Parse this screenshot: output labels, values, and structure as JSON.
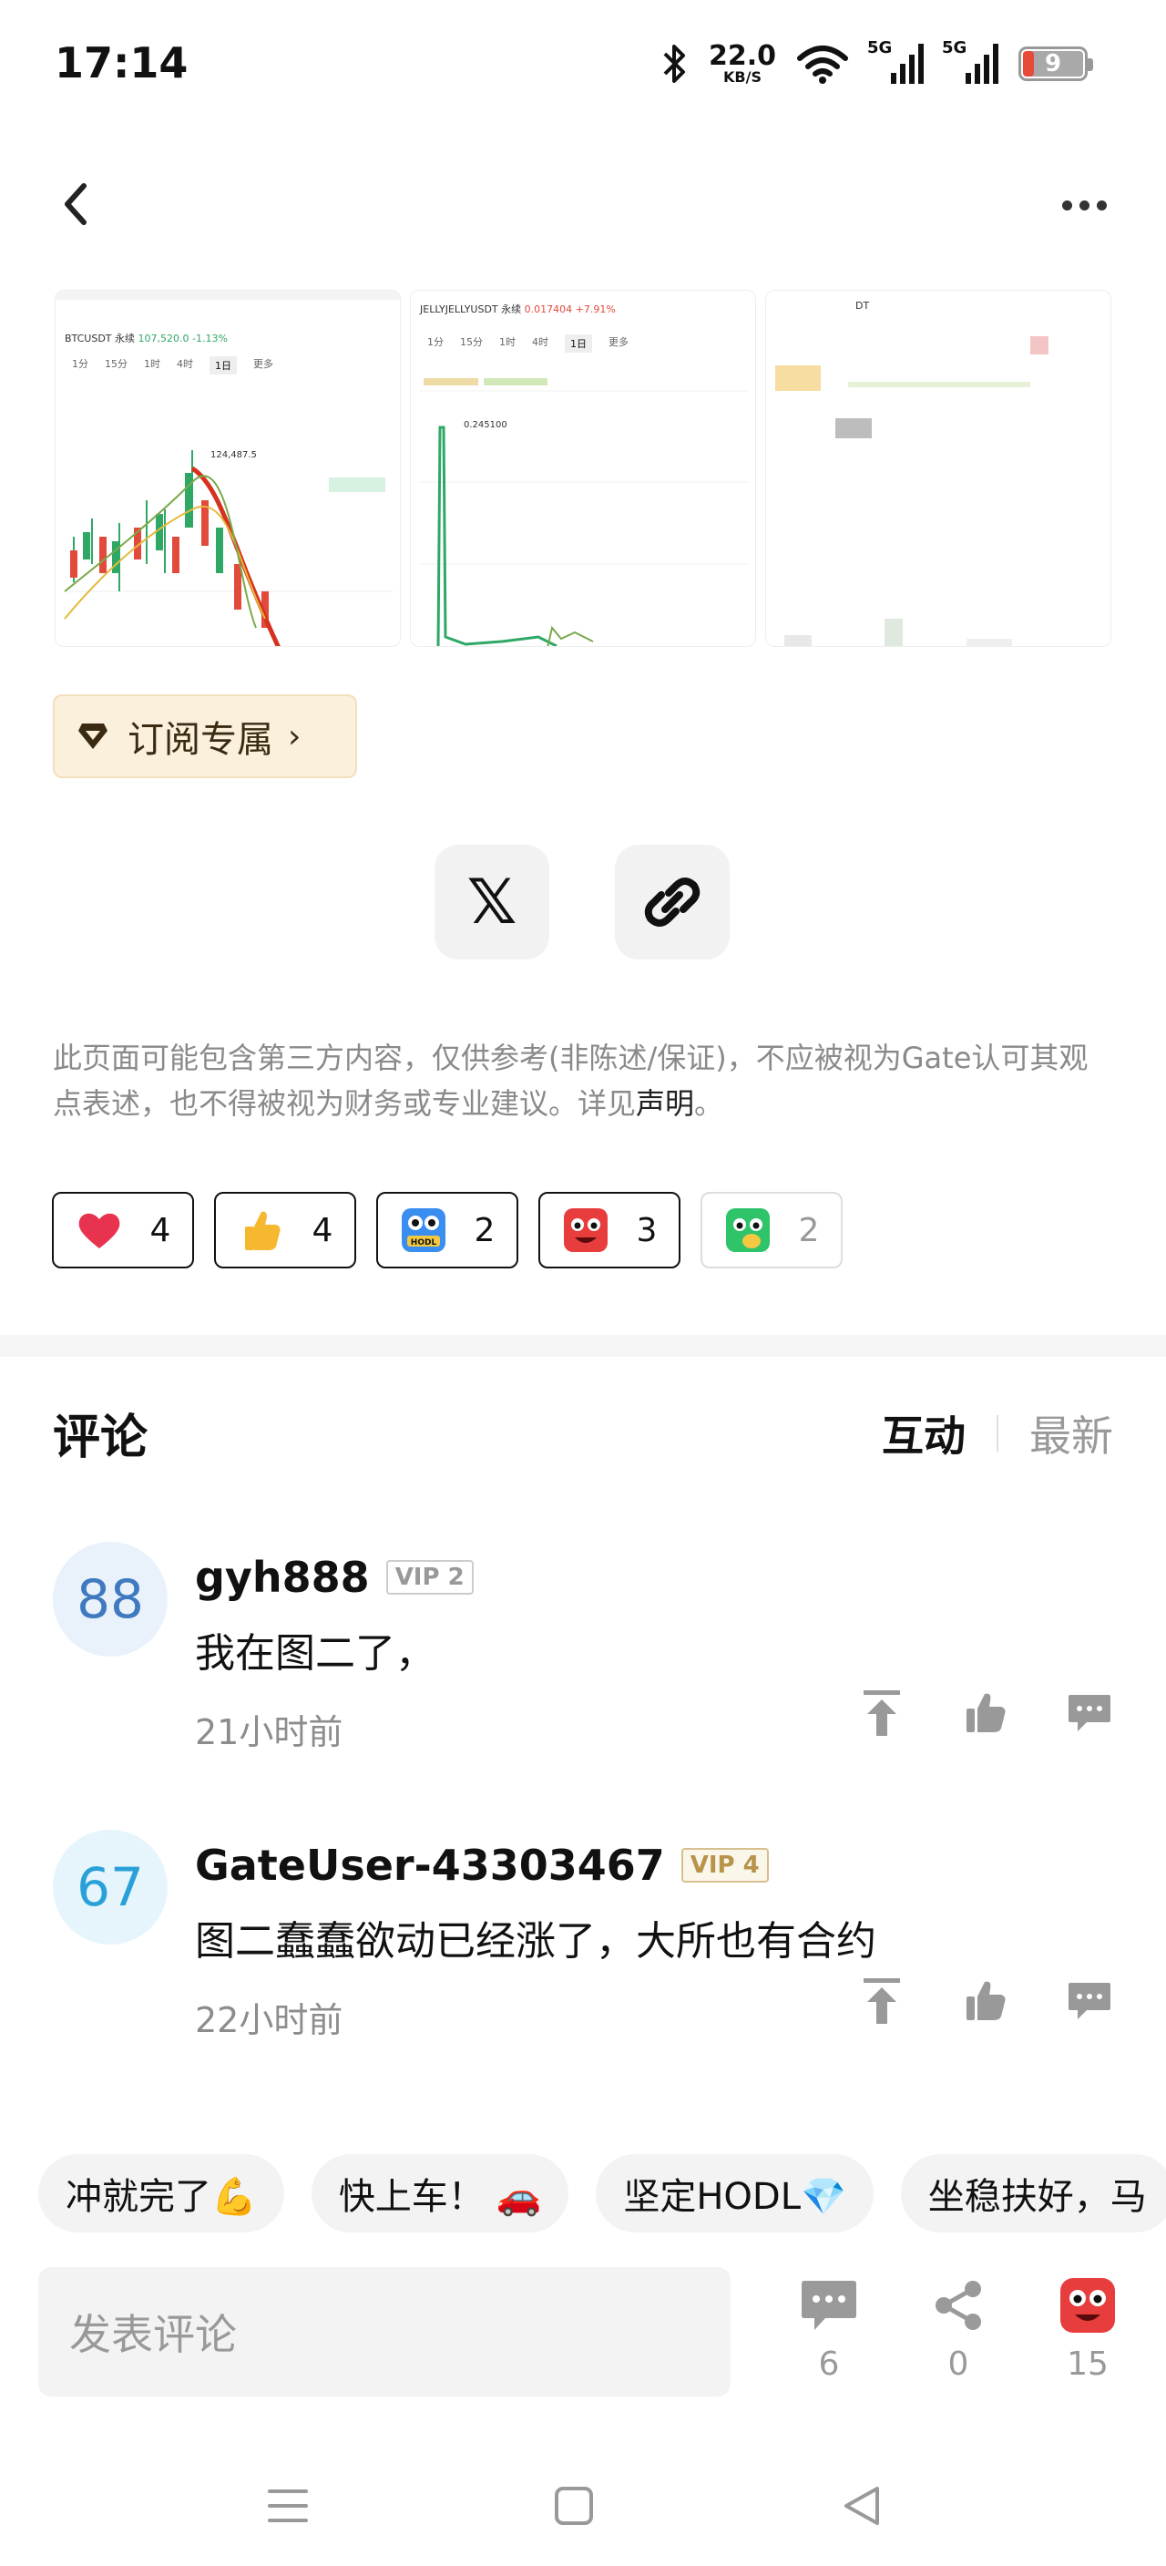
{
  "status_bar": {
    "time": "17:14",
    "net_speed_value": "22.0",
    "net_speed_unit": "KB/S",
    "sim1_label": "5G",
    "sim2_label": "5G",
    "battery": "9"
  },
  "header": {
    "back_icon": "chevron-left-icon",
    "more_icon": "more-icon"
  },
  "images": [
    {
      "pair": "BTCUSDT 永续",
      "price": "107,520.0",
      "change": "-1.13%",
      "marker": "124,487.5",
      "timeframes": [
        "1分",
        "15分",
        "1时",
        "4时",
        "1日",
        "更多"
      ],
      "active_tf": "1日"
    },
    {
      "pair": "JELLYJELLYUSDT 永续",
      "price": "0.017404",
      "change": "+7.91%",
      "marker": "0.245100",
      "timeframes": [
        "1分",
        "15分",
        "1时",
        "4时",
        "1日",
        "更多"
      ],
      "active_tf": "1日"
    },
    {
      "pair": "DT"
    }
  ],
  "subscribe": {
    "label": "订阅专属"
  },
  "share": {
    "x_label": "𝕏"
  },
  "disclaimer": {
    "text": "此页面可能包含第三方内容，仅供参考(非陈述/保证)，不应被视为Gate认可其观点表述，也不得被视为财务或专业建议。详见",
    "link": "声明",
    "end": "。"
  },
  "reactions": [
    {
      "name": "heart",
      "count": "4"
    },
    {
      "name": "thumbs-up",
      "count": "4"
    },
    {
      "name": "hodl",
      "count": "2"
    },
    {
      "name": "angry-face",
      "count": "3"
    },
    {
      "name": "green-face",
      "count": "2"
    }
  ],
  "comments_section": {
    "title": "评论",
    "sort_active": "互动",
    "sort_inactive": "最新"
  },
  "comments": [
    {
      "avatar": "88",
      "user": "gyh888",
      "vip": "VIP 2",
      "text": "我在图二了，",
      "time": "21小时前"
    },
    {
      "avatar": "67",
      "user": "GateUser-43303467",
      "vip": "VIP 4",
      "text": "图二蠢蠢欲动已经涨了，大所也有合约",
      "time": "22小时前"
    }
  ],
  "quick_replies": [
    "冲就完了💪",
    "快上车！ 🚗",
    "坚定HODL💎",
    "坐稳扶好，马"
  ],
  "bottom_bar": {
    "placeholder": "发表评论",
    "comments_count": "6",
    "shares_count": "0",
    "reactions_count": "15"
  },
  "colors": {
    "accent_gold": "#fbf0dc",
    "avatar_blue": "#3f7ac0",
    "link": "#222222",
    "muted": "#8c8c8c"
  }
}
